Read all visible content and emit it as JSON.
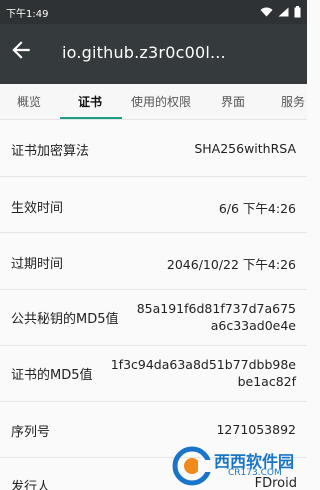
{
  "statusbar": {
    "time": "下午1:49"
  },
  "appbar": {
    "title": "io.github.z3r0c00l..."
  },
  "tabs": [
    {
      "label": "概览"
    },
    {
      "label": "证书"
    },
    {
      "label": "使用的权限"
    },
    {
      "label": "界面"
    },
    {
      "label": "服务"
    }
  ],
  "active_tab": "证书",
  "rows": [
    {
      "label": "证书加密算法",
      "value": "SHA256withRSA"
    },
    {
      "label": "生效时间",
      "value": "6/6 下午4:26"
    },
    {
      "label": "过期时间",
      "value": "2046/10/22 下午4:26"
    },
    {
      "label": "公共秘钥的MD5值",
      "value_line1": "85a191f6d81f737d7a675",
      "value_line2": "a6c33ad0e4e"
    },
    {
      "label": "证书的MD5值",
      "value_line1": "1f3c94da63a8d51b77dbb98e",
      "value_line2": "be1ac82f"
    },
    {
      "label": "序列号",
      "value": "1271053892"
    },
    {
      "label": "发行人",
      "value": "FDroid"
    }
  ],
  "watermark": {
    "brand": "西西软件园",
    "sub": "CR173.COM"
  },
  "colors": {
    "accent": "#1e9e86",
    "appbar": "#353a3c",
    "statusbar": "#2e3234"
  }
}
